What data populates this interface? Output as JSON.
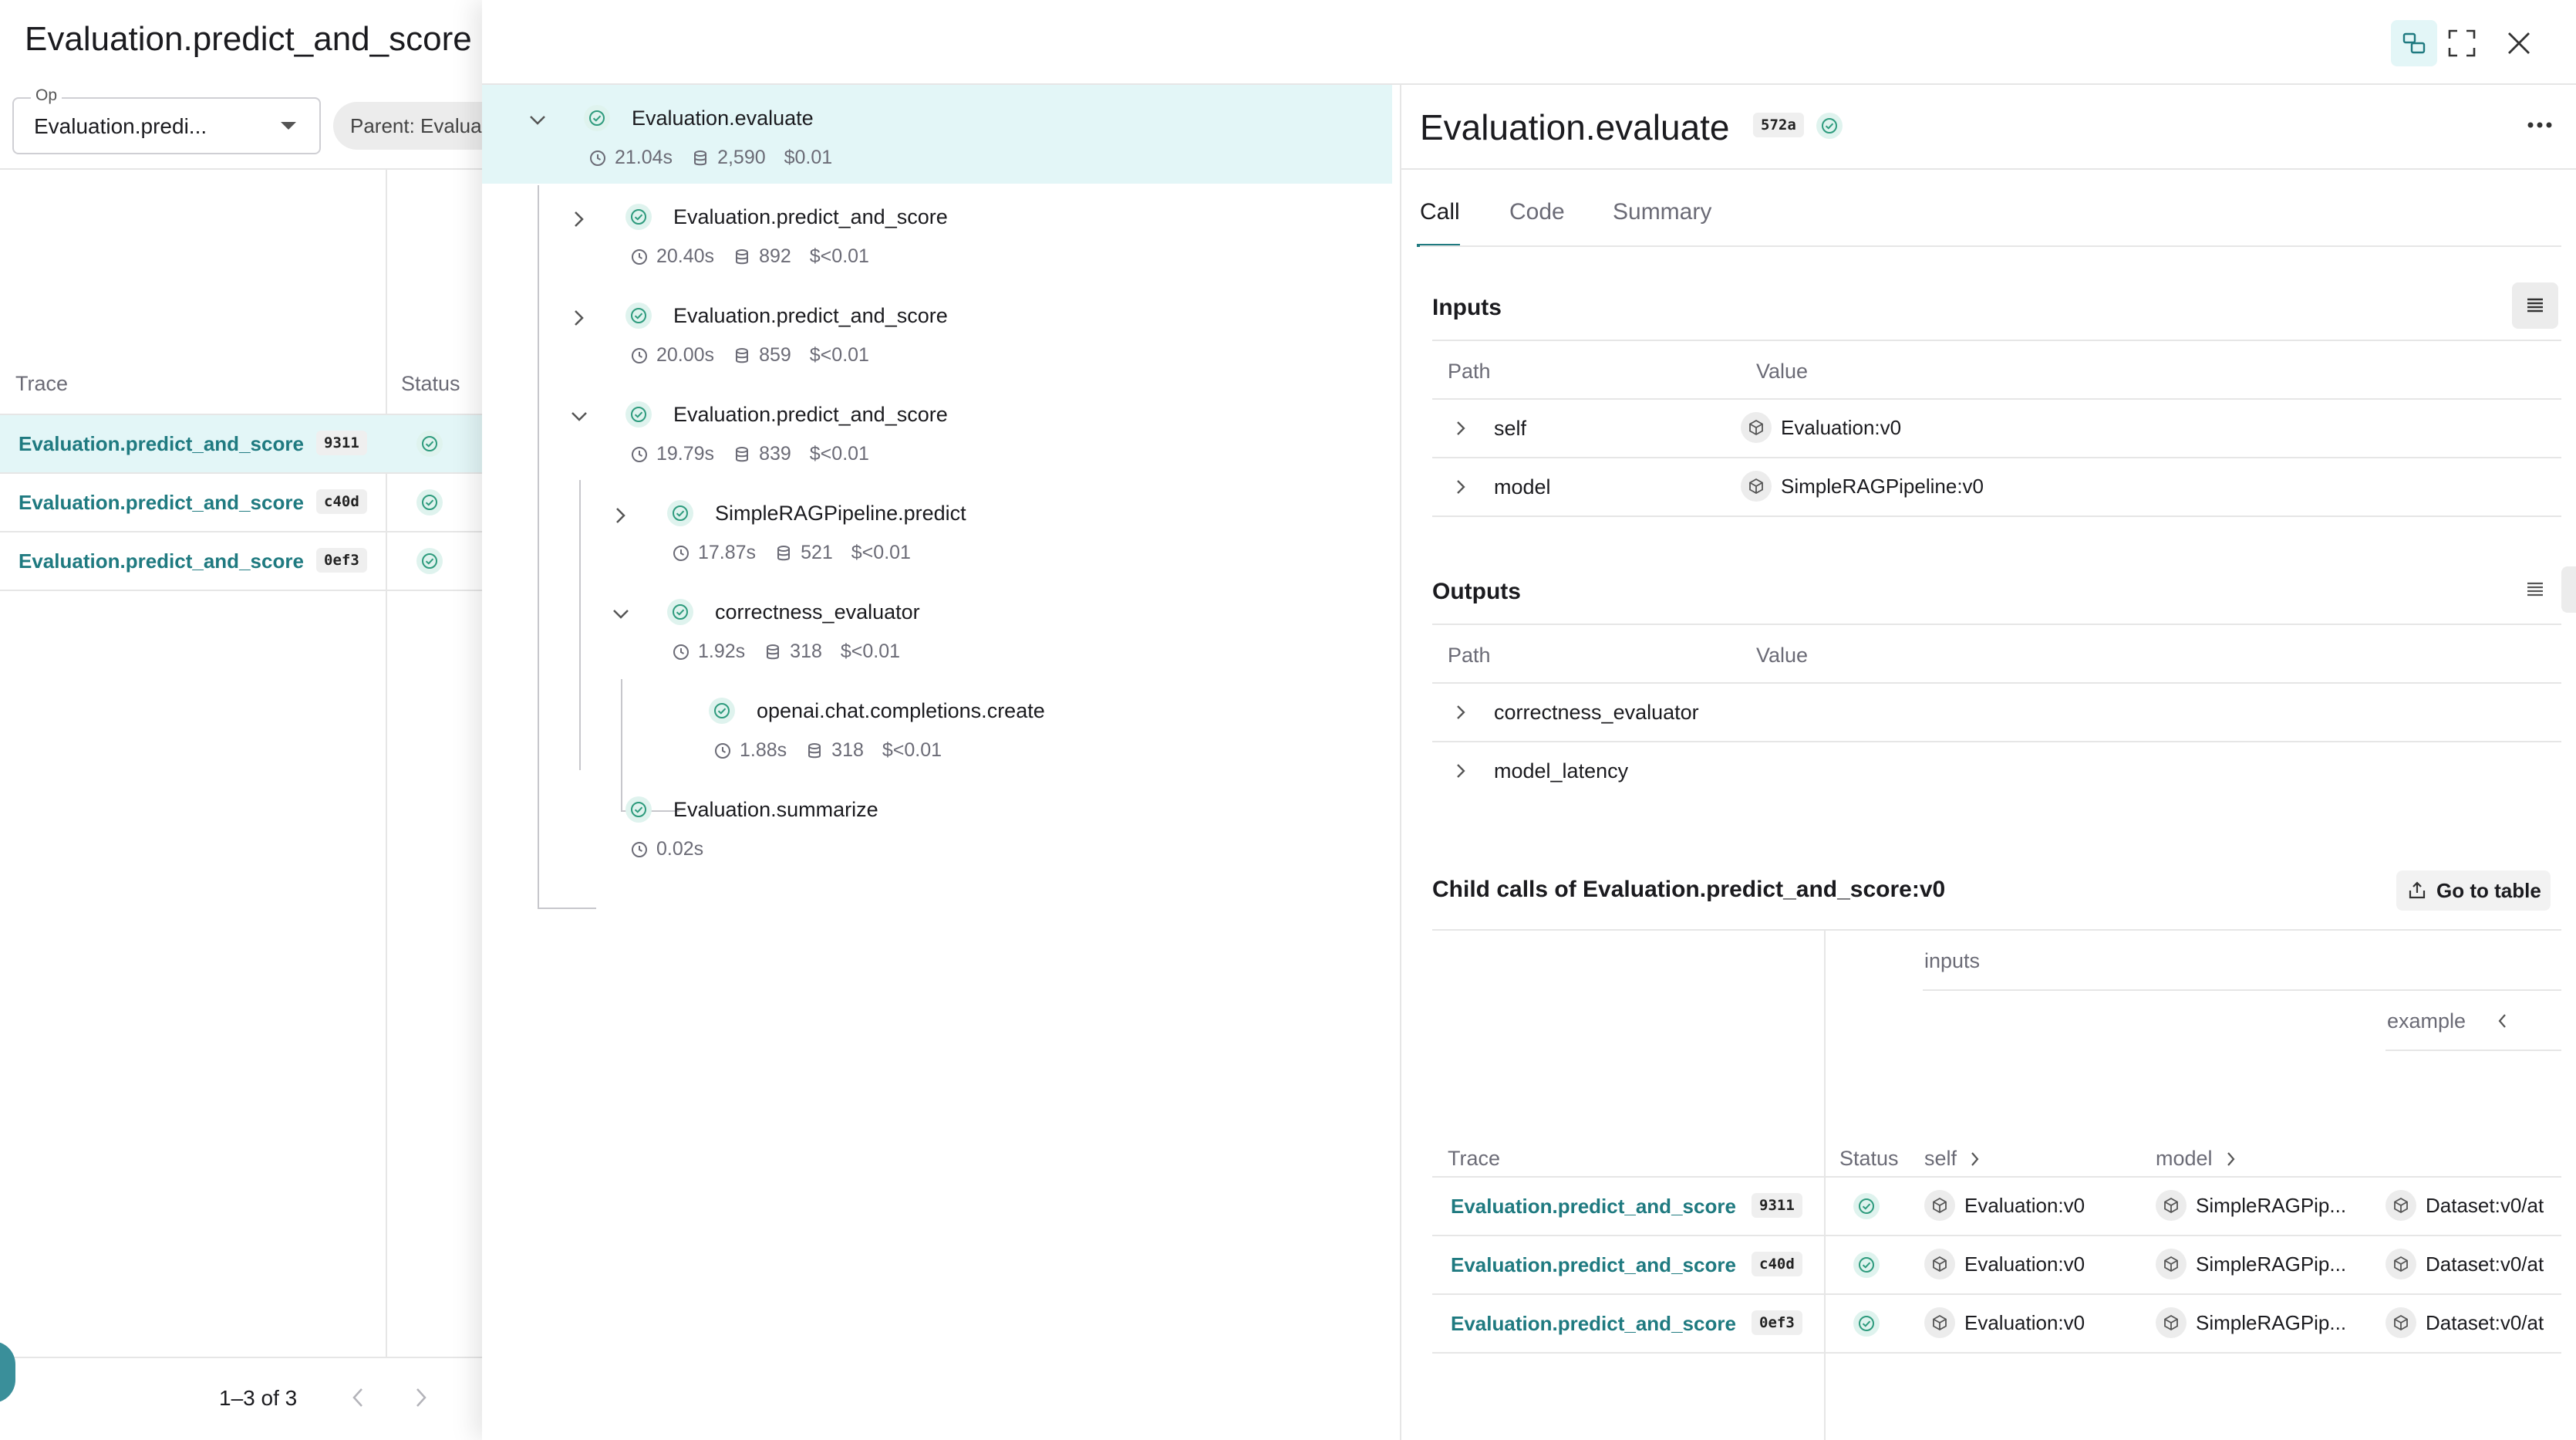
{
  "page_title": "Evaluation.predict_and_score",
  "filters": {
    "op_label": "Op",
    "op_value": "Evaluation.predi...",
    "parent_chip": "Parent: Evalua"
  },
  "left_table": {
    "col_trace": "Trace",
    "col_status": "Status",
    "rows": [
      {
        "name": "Evaluation.predict_and_score",
        "id": "9311"
      },
      {
        "name": "Evaluation.predict_and_score",
        "id": "c40d"
      },
      {
        "name": "Evaluation.predict_and_score",
        "id": "0ef3"
      }
    ],
    "pagination": "1–3 of 3"
  },
  "tree": [
    {
      "name": "Evaluation.evaluate",
      "latency": "21.04s",
      "tokens": "2,590",
      "cost": "$0.01"
    },
    {
      "name": "Evaluation.predict_and_score",
      "latency": "20.40s",
      "tokens": "892",
      "cost": "$<0.01"
    },
    {
      "name": "Evaluation.predict_and_score",
      "latency": "20.00s",
      "tokens": "859",
      "cost": "$<0.01"
    },
    {
      "name": "Evaluation.predict_and_score",
      "latency": "19.79s",
      "tokens": "839",
      "cost": "$<0.01"
    },
    {
      "name": "SimpleRAGPipeline.predict",
      "latency": "17.87s",
      "tokens": "521",
      "cost": "$<0.01"
    },
    {
      "name": "correctness_evaluator",
      "latency": "1.92s",
      "tokens": "318",
      "cost": "$<0.01"
    },
    {
      "name": "openai.chat.completions.create",
      "latency": "1.88s",
      "tokens": "318",
      "cost": "$<0.01"
    },
    {
      "name": "Evaluation.summarize",
      "latency": "0.02s"
    }
  ],
  "detail": {
    "title": "Evaluation.evaluate",
    "id": "572a",
    "tabs": [
      "Call",
      "Code",
      "Summary"
    ],
    "inputs": {
      "title": "Inputs",
      "col_path": "Path",
      "col_value": "Value",
      "rows": [
        {
          "path": "self",
          "value": "Evaluation:v0"
        },
        {
          "path": "model",
          "value": "SimpleRAGPipeline:v0"
        }
      ]
    },
    "outputs": {
      "title": "Outputs",
      "col_path": "Path",
      "col_value": "Value",
      "rows": [
        {
          "path": "correctness_evaluator"
        },
        {
          "path": "model_latency"
        }
      ]
    },
    "child_calls": {
      "title": "Child calls of Evaluation.predict_and_score:v0",
      "go_to_table": "Go to table",
      "group_inputs": "inputs",
      "group_example": "example",
      "col_trace": "Trace",
      "col_status": "Status",
      "col_self": "self",
      "col_model": "model",
      "rows": [
        {
          "name": "Evaluation.predict_and_score",
          "id": "9311",
          "self": "Evaluation:v0",
          "model": "SimpleRAGPip...",
          "example": "Dataset:v0/at"
        },
        {
          "name": "Evaluation.predict_and_score",
          "id": "c40d",
          "self": "Evaluation:v0",
          "model": "SimpleRAGPip...",
          "example": "Dataset:v0/at"
        },
        {
          "name": "Evaluation.predict_and_score",
          "id": "0ef3",
          "self": "Evaluation:v0",
          "model": "SimpleRAGPip...",
          "example": "Dataset:v0/at"
        }
      ]
    }
  },
  "colors": {
    "accent": "#1f7a80",
    "selected_row": "#e3f6f7",
    "success_bg": "#dff3ee",
    "success_fg": "#2e9b7d"
  }
}
